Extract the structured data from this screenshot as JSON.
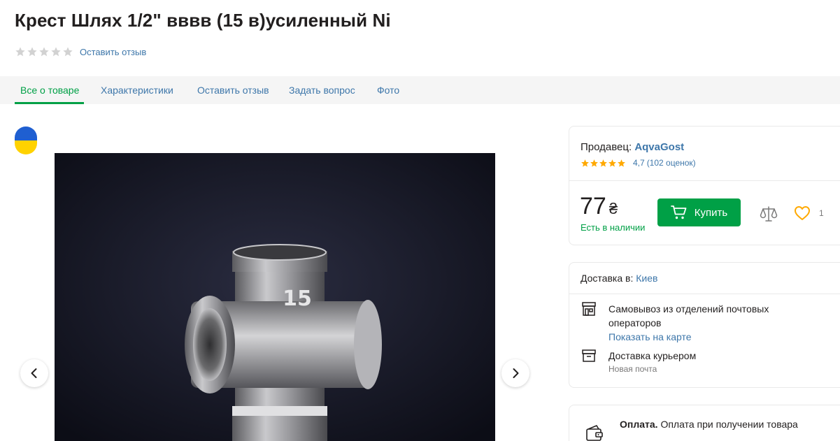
{
  "product": {
    "title": "Крест Шлях 1/2\" вввв (15 в)усиленный Ni",
    "review_link": "Оставить отзыв",
    "rating": 0,
    "photo_label": "15"
  },
  "tabs": [
    {
      "label": "Все о товаре",
      "active": true
    },
    {
      "label": "Характеристики",
      "active": false
    },
    {
      "label": "Оставить отзыв",
      "active": false
    },
    {
      "label": "Задать вопрос",
      "active": false
    },
    {
      "label": "Фото",
      "active": false
    }
  ],
  "seller": {
    "prefix": "Продавец:",
    "name": "AqvaGost",
    "rating": "4,7",
    "rating_count": "(102 оценок)"
  },
  "offer": {
    "price": "77",
    "currency": "₴",
    "stock": "Есть в наличии",
    "buy_label": "Купить",
    "favorites_count": "1"
  },
  "delivery": {
    "prefix": "Доставка в:",
    "city": "Киев",
    "pickup_text": "Самовывоз из отделений почтовых операторов",
    "pickup_link": "Показать на карте",
    "courier_text": "Доставка курьером",
    "courier_sub": "Новая почта"
  },
  "payment": {
    "label": "Оплата.",
    "text": "Оплата при получении товара"
  },
  "colors": {
    "accent_green": "#00a046",
    "link_blue": "#3e77aa",
    "star_gold": "#ffa900",
    "star_empty": "#d2d2d2"
  }
}
